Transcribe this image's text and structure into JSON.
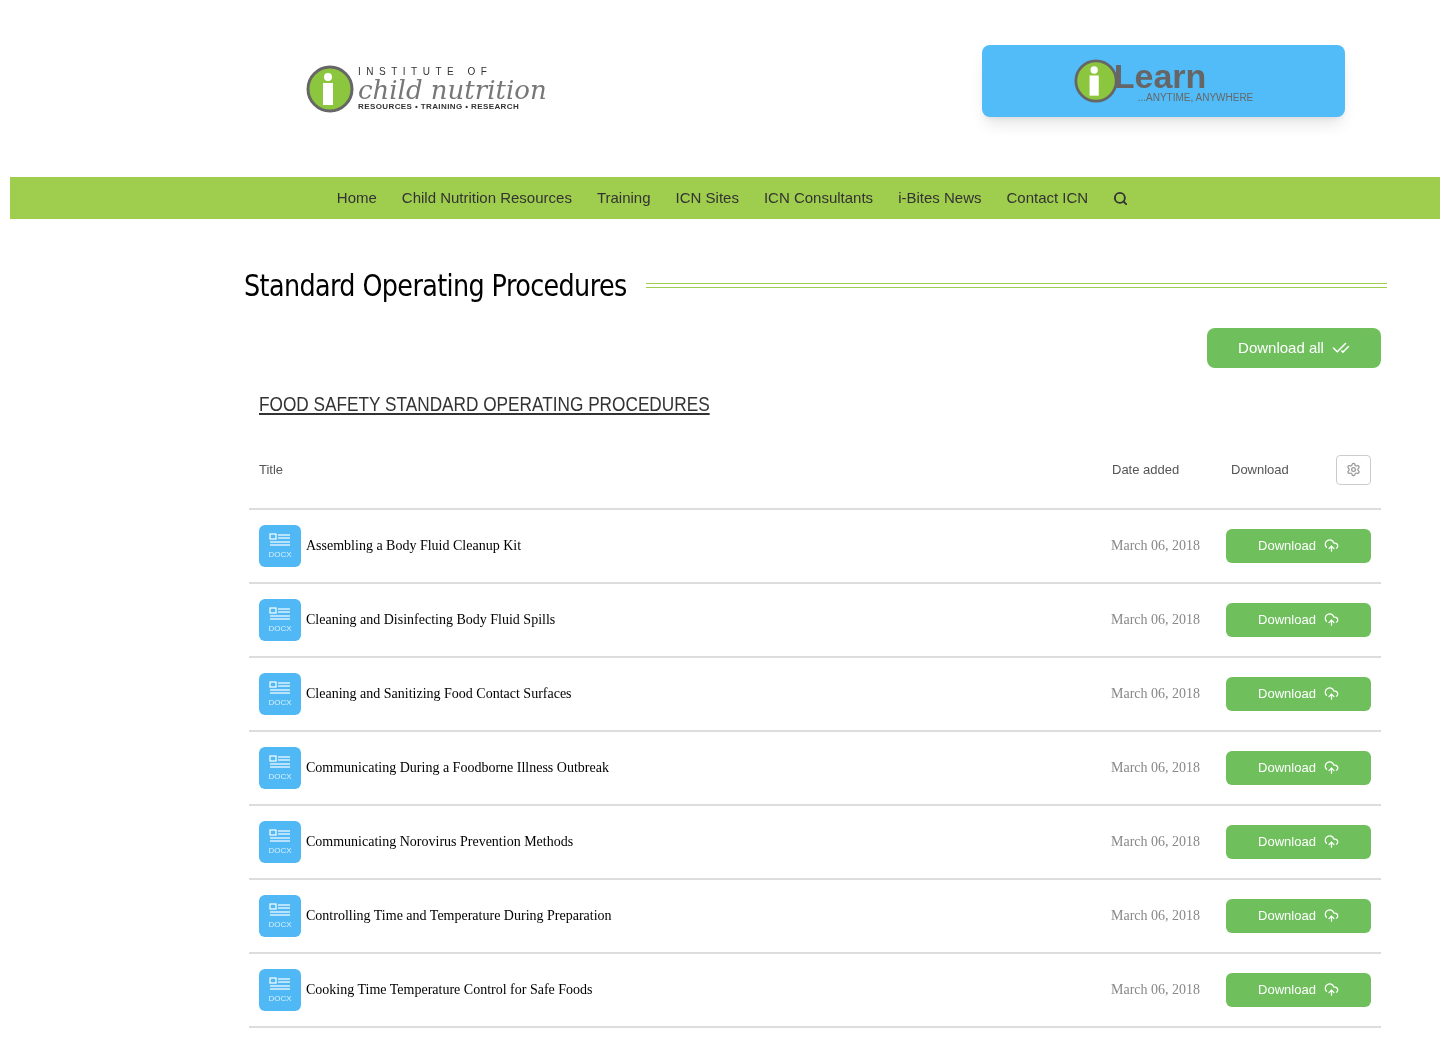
{
  "logo": {
    "top": "INSTITUTE OF",
    "main": "child nutrition",
    "tagline": "RESOURCES • TRAINING • RESEARCH"
  },
  "ilearn": {
    "word": "Learn",
    "tagline": "...ANYTIME, ANYWHERE"
  },
  "nav": [
    "Home",
    "Child Nutrition Resources",
    "Training",
    "ICN Sites",
    "ICN Consultants",
    "i-Bites News",
    "Contact ICN"
  ],
  "page_title": "Standard Operating Procedures",
  "download_all": "Download all",
  "section_title": "FOOD SAFETY STANDARD OPERATING PROCEDURES",
  "columns": [
    "Title",
    "Date added",
    "Download"
  ],
  "rows": [
    {
      "title": "Assembling a Body Fluid Cleanup Kit",
      "date": "March 06, 2018",
      "button": "Download",
      "file_type": "DOCX"
    },
    {
      "title": "Cleaning and Disinfecting Body Fluid Spills",
      "date": "March 06, 2018",
      "button": "Download",
      "file_type": "DOCX"
    },
    {
      "title": "Cleaning and Sanitizing Food Contact Surfaces",
      "date": "March 06, 2018",
      "button": "Download",
      "file_type": "DOCX"
    },
    {
      "title": "Communicating During a Foodborne Illness Outbreak",
      "date": "March 06, 2018",
      "button": "Download",
      "file_type": "DOCX"
    },
    {
      "title": "Communicating Norovirus Prevention Methods",
      "date": "March 06, 2018",
      "button": "Download",
      "file_type": "DOCX"
    },
    {
      "title": "Controlling Time and Temperature During Preparation",
      "date": "March 06, 2018",
      "button": "Download",
      "file_type": "DOCX"
    },
    {
      "title": "Cooking Time Temperature Control for Safe Foods",
      "date": "March 06, 2018",
      "button": "Download",
      "file_type": "DOCX"
    }
  ]
}
